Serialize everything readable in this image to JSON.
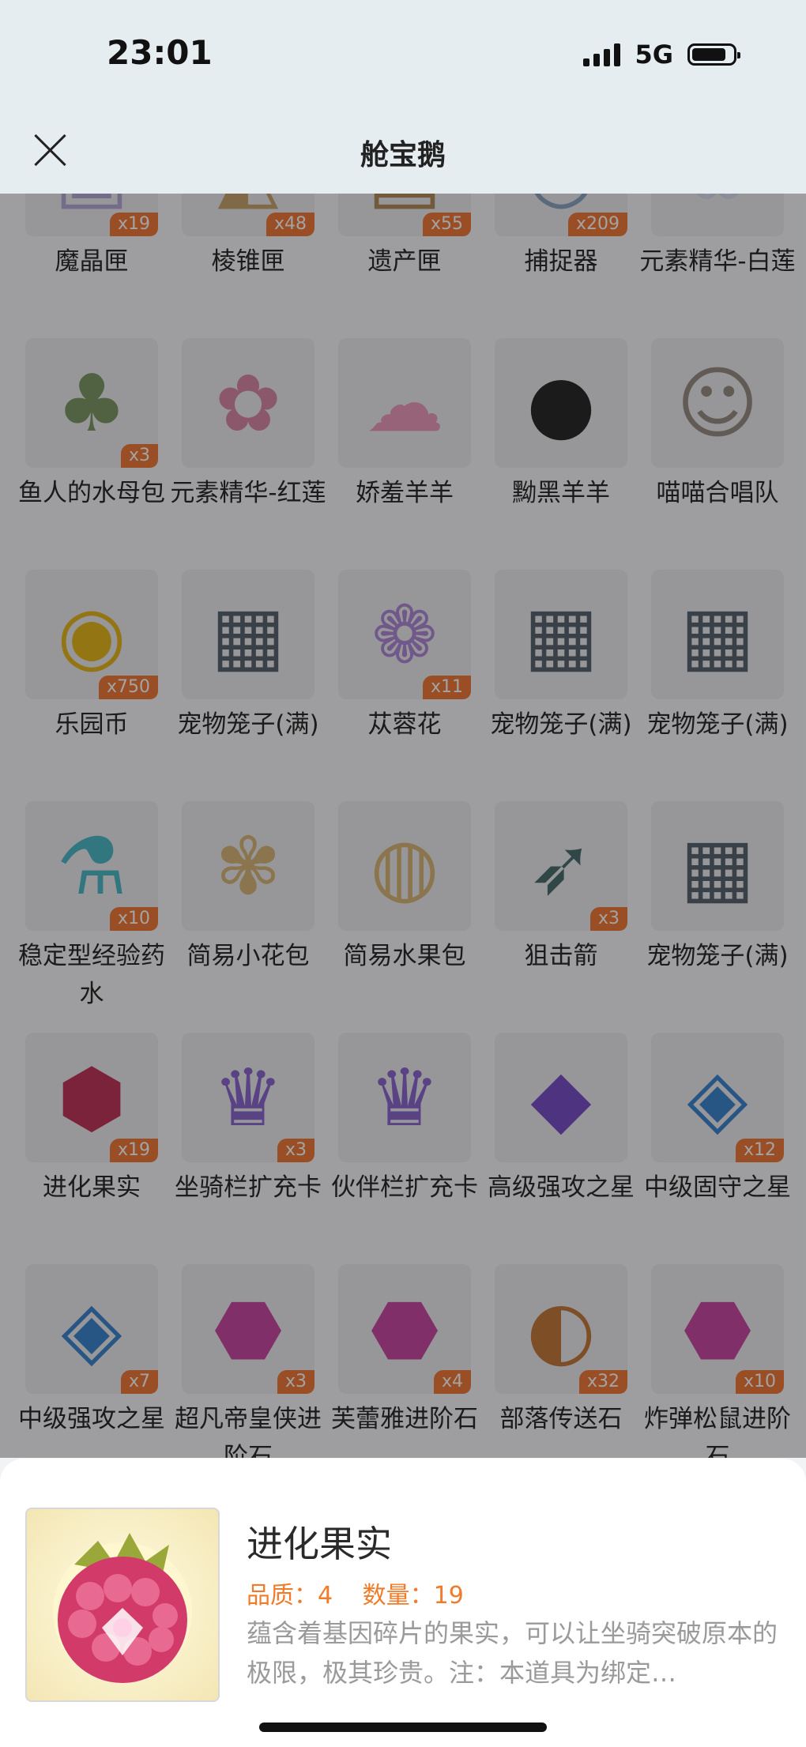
{
  "status": {
    "time": "23:01",
    "network": "5G"
  },
  "nav": {
    "title": "舱宝鹅"
  },
  "grid": {
    "rows": [
      [
        {
          "name": "魔晶匣",
          "qty": "x19",
          "icon": "crystal-box-icon"
        },
        {
          "name": "棱锥匣",
          "qty": "x48",
          "icon": "pyramid-box-icon"
        },
        {
          "name": "遗产匣",
          "qty": "x55",
          "icon": "legacy-box-icon"
        },
        {
          "name": "捕捉器",
          "qty": "x209",
          "icon": "catcher-icon"
        },
        {
          "name": "元素精华-白莲",
          "qty": "",
          "icon": "white-lotus-essence-icon"
        }
      ],
      [
        {
          "name": "鱼人的水母包",
          "qty": "x3",
          "icon": "jellyfish-bag-icon"
        },
        {
          "name": "元素精华-红莲",
          "qty": "",
          "icon": "red-lotus-essence-icon"
        },
        {
          "name": "娇羞羊羊",
          "qty": "",
          "icon": "pink-sheep-icon"
        },
        {
          "name": "黝黑羊羊",
          "qty": "",
          "icon": "black-sheep-icon"
        },
        {
          "name": "喵喵合唱队",
          "qty": "",
          "icon": "cat-choir-icon"
        }
      ],
      [
        {
          "name": "乐园币",
          "qty": "x750",
          "icon": "coin-icon"
        },
        {
          "name": "宠物笼子(满)",
          "qty": "",
          "icon": "pet-cage-icon"
        },
        {
          "name": "苁蓉花",
          "qty": "x11",
          "icon": "flower-icon"
        },
        {
          "name": "宠物笼子(满)",
          "qty": "",
          "icon": "pet-cage-icon"
        },
        {
          "name": "宠物笼子(满)",
          "qty": "",
          "icon": "pet-cage-icon"
        }
      ],
      [
        {
          "name": "稳定型经验药水",
          "qty": "x10",
          "icon": "potion-icon"
        },
        {
          "name": "简易小花包",
          "qty": "",
          "icon": "flower-bag-icon"
        },
        {
          "name": "简易水果包",
          "qty": "",
          "icon": "fruit-bag-icon"
        },
        {
          "name": "狙击箭",
          "qty": "x3",
          "icon": "arrow-icon"
        },
        {
          "name": "宠物笼子(满)",
          "qty": "",
          "icon": "pet-cage-icon"
        }
      ],
      [
        {
          "name": "进化果实",
          "qty": "x19",
          "icon": "raspberry-icon"
        },
        {
          "name": "坐骑栏扩充卡",
          "qty": "x3",
          "icon": "crown-card-icon"
        },
        {
          "name": "伙伴栏扩充卡",
          "qty": "",
          "icon": "crown-card-icon"
        },
        {
          "name": "高级强攻之星",
          "qty": "",
          "icon": "purple-gem-icon"
        },
        {
          "name": "中级固守之星",
          "qty": "x12",
          "icon": "blue-gem-icon"
        }
      ],
      [
        {
          "name": "中级强攻之星",
          "qty": "x7",
          "icon": "blue-gem-icon"
        },
        {
          "name": "超凡帝皇侠进阶石",
          "qty": "x3",
          "icon": "evolve-stone-icon"
        },
        {
          "name": "芙蕾雅进阶石",
          "qty": "x4",
          "icon": "evolve-stone-icon"
        },
        {
          "name": "部落传送石",
          "qty": "x32",
          "icon": "teleport-stone-icon"
        },
        {
          "name": "炸弹松鼠进阶石",
          "qty": "x10",
          "icon": "evolve-stone-icon"
        }
      ]
    ]
  },
  "detail": {
    "title": "进化果实",
    "quality_label": "品质：4",
    "count_label": "数量：19",
    "description": "蕴含着基因碎片的果实，可以让坐骑突破原本的极限，极其珍贵。注：本道具为绑定…"
  }
}
